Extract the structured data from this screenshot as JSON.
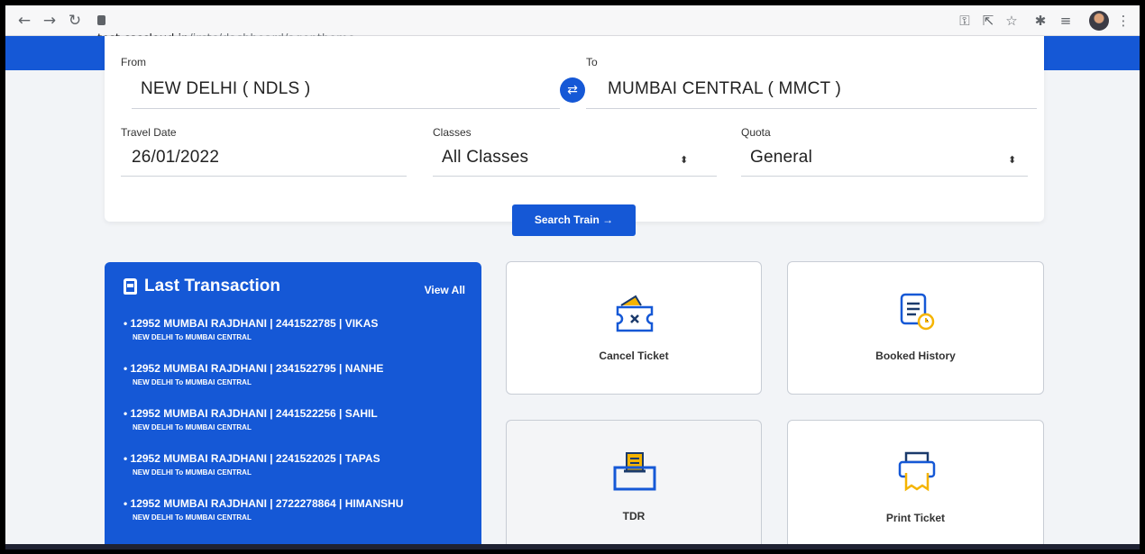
{
  "browser": {
    "url_host": "test.csccloud.in",
    "url_path": "/irctc/dashboard/agenthome"
  },
  "search_form": {
    "from_label": "From",
    "from_value": "NEW DELHI ( NDLS )",
    "to_label": "To",
    "to_value": "MUMBAI CENTRAL ( MMCT )",
    "date_label": "Travel Date",
    "date_value": "26/01/2022",
    "classes_label": "Classes",
    "classes_value": "All Classes",
    "quota_label": "Quota",
    "quota_value": "General",
    "search_button": "Search Train →"
  },
  "last_transaction": {
    "title": "Last Transaction",
    "view_all": "View All",
    "items": [
      {
        "text": "• 12952 MUMBAI RAJDHANI  |  2441522785  |  VIKAS",
        "route": "NEW DELHI To MUMBAI CENTRAL"
      },
      {
        "text": "• 12952 MUMBAI RAJDHANI  |  2341522795  |  NANHE",
        "route": "NEW DELHI To MUMBAI CENTRAL"
      },
      {
        "text": "• 12952 MUMBAI RAJDHANI  |  2441522256  |  SAHIL",
        "route": "NEW DELHI To MUMBAI CENTRAL"
      },
      {
        "text": "• 12952 MUMBAI RAJDHANI  |  2241522025  |  TAPAS",
        "route": "NEW DELHI To MUMBAI CENTRAL"
      },
      {
        "text": "• 12952 MUMBAI RAJDHANI  |  2722278864  |  HIMANSHU",
        "route": "NEW DELHI To MUMBAI CENTRAL"
      }
    ]
  },
  "tiles": {
    "cancel": "Cancel Ticket",
    "history": "Booked History",
    "tdr": "TDR",
    "print": "Print Ticket"
  },
  "colors": {
    "primary": "#1558d6",
    "accent": "#f5b400"
  }
}
